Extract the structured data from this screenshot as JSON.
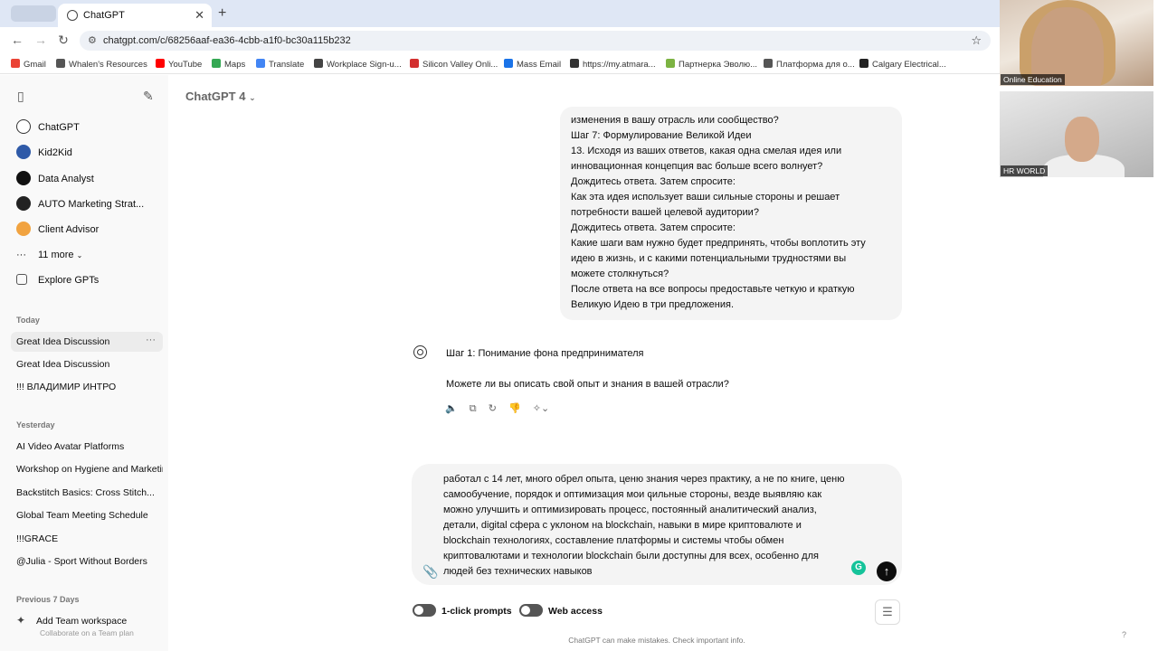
{
  "browser": {
    "tab_title": "ChatGPT",
    "url": "chatgpt.com/c/68256aaf-ea36-4cbb-a1f0-bc30a115b232",
    "bookmarks": [
      {
        "label": "Gmail",
        "color": "#ea4335"
      },
      {
        "label": "Whalen's Resources",
        "color": "#555555"
      },
      {
        "label": "YouTube",
        "color": "#ff0000"
      },
      {
        "label": "Maps",
        "color": "#34a853"
      },
      {
        "label": "Translate",
        "color": "#4285f4"
      },
      {
        "label": "Workplace Sign-u...",
        "color": "#444444"
      },
      {
        "label": "Silicon Valley Onli...",
        "color": "#d32f2f"
      },
      {
        "label": "Mass Email",
        "color": "#1a73e8"
      },
      {
        "label": "https://my.atmara...",
        "color": "#333333"
      },
      {
        "label": "Партнерка Эволю...",
        "color": "#7cb342"
      },
      {
        "label": "Платформа для о...",
        "color": "#555555"
      },
      {
        "label": "Calgary Electrical...",
        "color": "#222222"
      }
    ]
  },
  "video": {
    "tile1_label": "Online Education",
    "tile2_label": "HR WORLD"
  },
  "sidebar": {
    "gpts": [
      {
        "label": "ChatGPT",
        "color": "#ffffff"
      },
      {
        "label": "Kid2Kid",
        "color": "#2f5aa8"
      },
      {
        "label": "Data Analyst",
        "color": "#111111"
      },
      {
        "label": "AUTO Marketing Strat...",
        "color": "#222222"
      },
      {
        "label": "Client Advisor",
        "color": "#f1a340"
      }
    ],
    "more_label": "11 more",
    "explore_label": "Explore GPTs",
    "today_label": "Today",
    "today": [
      "Great Idea Discussion",
      "Great Idea Discussion",
      "!!! ВЛАДИМИР ИНТРО"
    ],
    "yesterday_label": "Yesterday",
    "yesterday": [
      "AI Video Avatar Platforms",
      "Workshop on Hygiene and Marketing",
      "Backstitch Basics: Cross Stitch...",
      "Global Team Meeting Schedule",
      "!!!GRACE",
      "@Julia - Sport Without Borders"
    ],
    "prev7_label": "Previous 7 Days",
    "team_title": "Add Team workspace",
    "team_sub": "Collaborate on a Team plan"
  },
  "main": {
    "model_label": "ChatGPT 4",
    "user_message_lines": [
      "изменения в вашу отрасль или сообщество?",
      "Шаг 7: Формулирование Великой Идеи",
      "13. Исходя из ваших ответов, какая одна смелая идея или",
      "инновационная концепция вас больше всего волнует?",
      "Дождитесь ответа. Затем спросите:",
      "Как эта идея использует ваши сильные стороны и решает",
      "потребности вашей целевой аудитории?",
      "Дождитесь ответа. Затем спросите:",
      "Какие шаги вам нужно будет предпринять, чтобы воплотить эту",
      "идею в жизнь, и с какими потенциальными трудностями вы",
      "можете столкнуться?",
      "После ответа на все вопросы предоставьте четкую и краткую",
      "Великую Идею в три предложения."
    ],
    "assistant_line1": "Шаг 1: Понимание фона предпринимателя",
    "assistant_line2": "Можете ли вы описать свой опыт и знания в вашей отрасли?",
    "composer_lines": [
      "работал с 14 лет, много обрел опыта, ценю знания через практику, а не по книге, ценю",
      "самообучение, порядок и оптимизация мои сильные стороны, везде выявляю как",
      "можно улучшить и оптимизировать процесс,  постоянный аналитический анализ,",
      "детали, digital сфера с уклоном на blockchain, навыки в мире криптовалюте и",
      "blockchain технологиях, составление платформы и системы чтобы обмен",
      "криптовалютами и технологии blockchain были доступны для всех, особенно для",
      "людей без технических навыков"
    ],
    "toggle1": "1-click prompts",
    "toggle2": "Web access",
    "disclaimer": "ChatGPT can make mistakes. Check important info.",
    "help": "?"
  }
}
